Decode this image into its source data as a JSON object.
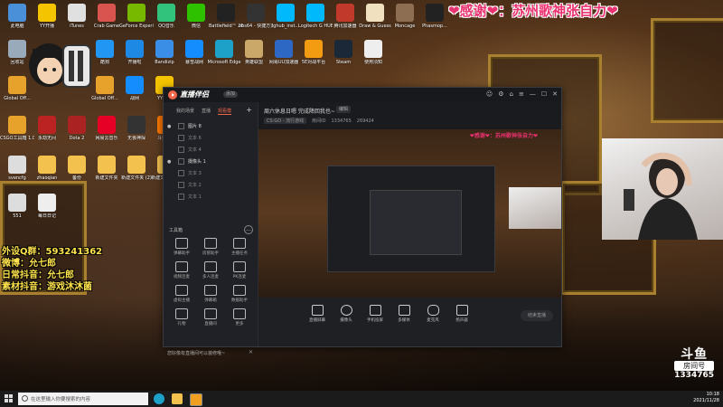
{
  "banner": {
    "text": "❤感谢❤：苏州歌神张自力❤"
  },
  "overlay": {
    "lines": [
      "外设Q群：593241362",
      "微博：允七郎",
      "日常抖音：允七郎",
      "素材抖音：游戏沐沐菌"
    ]
  },
  "desktop_icons": [
    {
      "label": "此电脑",
      "icon": "computer-icon",
      "color": "#4a90d9"
    },
    {
      "label": "YY开播",
      "icon": "yy-icon",
      "color": "#f5c400"
    },
    {
      "label": "iTunes",
      "icon": "itunes-icon",
      "color": "#e0e0e0"
    },
    {
      "label": "Crab Game",
      "icon": "crab-icon",
      "color": "#d9534f"
    },
    {
      "label": "GeForce Experience",
      "icon": "nvidia-icon",
      "color": "#76b900"
    },
    {
      "label": "QQ音乐",
      "icon": "qqmusic-icon",
      "color": "#31c27c"
    },
    {
      "label": "微信",
      "icon": "wechat-icon",
      "color": "#2dc100"
    },
    {
      "label": "Battlefield™ 2042 Open",
      "icon": "battlefield-icon",
      "color": "#222"
    },
    {
      "label": "obs64 - 快捷方式",
      "icon": "obs-icon",
      "color": "#333"
    },
    {
      "label": "lghub_inst...",
      "icon": "logitech-icon",
      "color": "#00b8fc"
    },
    {
      "label": "Logitech G HUB",
      "icon": "logitech-icon",
      "color": "#00b8fc"
    },
    {
      "label": "腾讯加速器",
      "icon": "accel-icon",
      "color": "#c0392b"
    },
    {
      "label": "Draw & Guess",
      "icon": "draw-icon",
      "color": "#f0e0c0"
    },
    {
      "label": "Moncage",
      "icon": "moncage-icon",
      "color": "#8e6e53"
    },
    {
      "label": "Phasmop...",
      "icon": "phasmo-icon",
      "color": "#222"
    },
    {
      "label": "回收站",
      "icon": "recycle-icon",
      "color": "#9ab"
    },
    {
      "label": "Global Off...",
      "icon": "csgo-icon",
      "color": "#e6a22b"
    },
    {
      "label": "酷狗",
      "icon": "kugou-icon",
      "color": "#2196f3"
    },
    {
      "label": "开播啦",
      "icon": "live-icon",
      "color": "#1e88e5"
    },
    {
      "label": "Bandizip",
      "icon": "bandizip-icon",
      "color": "#3b8ee6"
    },
    {
      "label": "暴雪战网",
      "icon": "battlenet-icon",
      "color": "#148eff"
    },
    {
      "label": "Microsoft Edge",
      "icon": "edge-icon",
      "color": "#1ea1c9"
    },
    {
      "label": "英雄联盟",
      "icon": "lol-icon",
      "color": "#c9a86a"
    },
    {
      "label": "网易UU加速器",
      "icon": "uu-icon",
      "color": "#2d68c4"
    },
    {
      "label": "5E对战平台",
      "icon": "fivee-icon",
      "color": "#f39c12"
    },
    {
      "label": "Steam",
      "icon": "steam-icon",
      "color": "#1b2838"
    },
    {
      "label": "使用须知",
      "icon": "file-icon",
      "color": "#eee"
    },
    {
      "label": "Global Off...",
      "icon": "csgo-icon",
      "color": "#e6a22b"
    },
    {
      "label": "战网",
      "icon": "battlenet-icon",
      "color": "#148eff"
    },
    {
      "label": "YY语音",
      "icon": "yy-icon",
      "color": "#f5c400"
    },
    {
      "label": "CSGO工具箱 1.0.1 (1)",
      "icon": "csgo-icon",
      "color": "#e6a22b"
    },
    {
      "label": "永劫无间",
      "icon": "naraka-icon",
      "color": "#b22"
    },
    {
      "label": "Dota 2",
      "icon": "dota-icon",
      "color": "#a22"
    },
    {
      "label": "网易云音乐",
      "icon": "netease-icon",
      "color": "#e60026"
    },
    {
      "label": "无畏神探",
      "icon": "game-icon",
      "color": "#333"
    },
    {
      "label": "斗鱼直播",
      "icon": "douyu-icon",
      "color": "#ff7700"
    },
    {
      "label": "svencfg",
      "icon": "file-icon",
      "color": "#ddd"
    },
    {
      "label": "zhaoqian",
      "icon": "folder-icon",
      "color": "#f2c14e"
    },
    {
      "label": "备份",
      "icon": "folder-icon",
      "color": "#f2c14e"
    },
    {
      "label": "新建文件夹",
      "icon": "folder-icon",
      "color": "#f2c14e"
    },
    {
      "label": "新建文件夹 (2)",
      "icon": "folder-icon",
      "color": "#f2c14e"
    },
    {
      "label": "新建文件夹 (3)",
      "icon": "folder-icon",
      "color": "#f2c14e"
    },
    {
      "label": "551",
      "icon": "file-icon",
      "color": "#ddd"
    },
    {
      "label": "每日日记",
      "icon": "file-icon",
      "color": "#eee"
    }
  ],
  "app": {
    "title": "直播伴侣",
    "badge": "添加",
    "window_buttons": [
      "☺",
      "⚙",
      "⌂",
      "≡",
      "—",
      "☐",
      "✕"
    ],
    "tabs": [
      "我的场景",
      "直播",
      "观看模"
    ],
    "active_tab": 2,
    "scenes": [
      {
        "label": "图片 8",
        "visible": true
      },
      {
        "label": "文本 6",
        "visible": false
      },
      {
        "label": "文本 4",
        "visible": false
      },
      {
        "label": "摄像头 1",
        "visible": true
      },
      {
        "label": "文本 3",
        "visible": false
      },
      {
        "label": "文本 2",
        "visible": false
      },
      {
        "label": "文本 1",
        "visible": false
      }
    ],
    "toolbox_title": "工具箱",
    "tools": [
      "弹幕助手",
      "房管助手",
      "主播任务",
      "视频连麦",
      "多人连麦",
      "PK连麦",
      "虚拟主播",
      "弹幕箱",
      "数据助手",
      "礼物",
      "直播间",
      "更多"
    ],
    "room_title": "周六休息日嗯 完成降回我也~",
    "room_edit": "编辑",
    "room_game": "CS:GO - 流行游戏",
    "room_id": "房间ID",
    "room_viewers": "1334765",
    "room_hot": "269424",
    "controls": [
      "直播屏幕",
      "摄像头",
      "手机投屏",
      "多媒体",
      "麦克风",
      "扬声器"
    ],
    "live_button": "结束直播",
    "notice": "您好像有直播间可以装修哦~"
  },
  "stream_logo": {
    "name": "斗鱼",
    "sub": "房间号",
    "number": "1334765"
  },
  "taskbar": {
    "search_placeholder": "在这里输入你要搜索的内容",
    "time": "10:18",
    "date": "2021/11/28"
  }
}
